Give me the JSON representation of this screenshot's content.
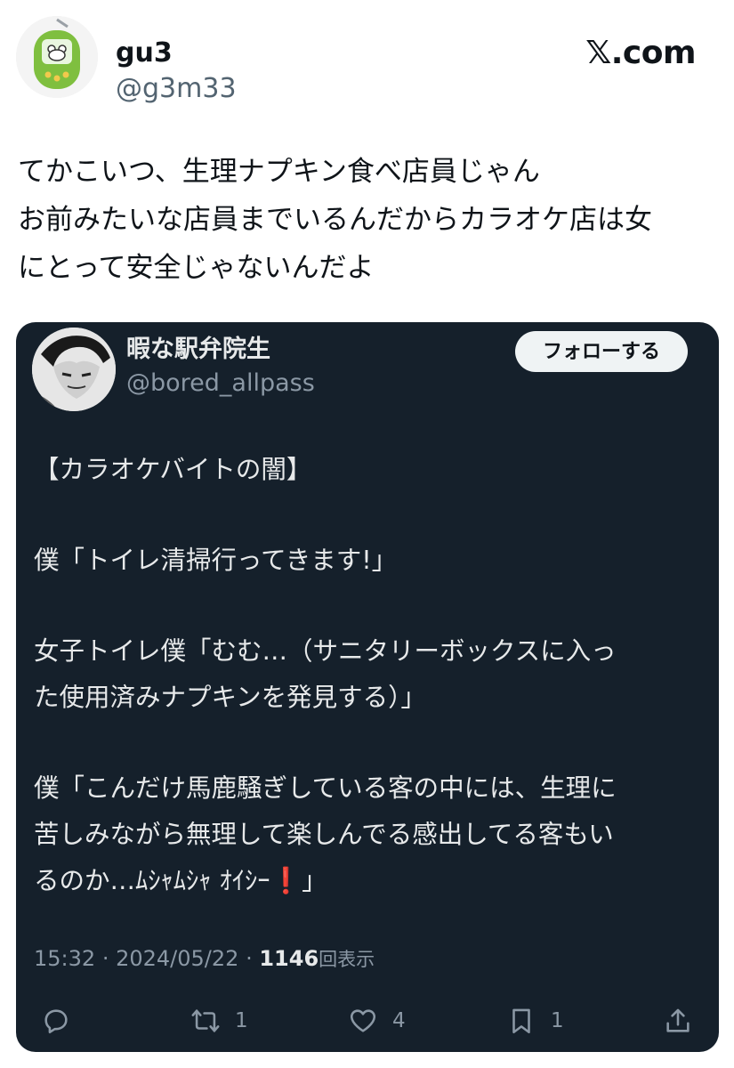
{
  "outer": {
    "name": "gu3",
    "handle": "@g3m33",
    "site_logo": "𝕏.com",
    "text_lines": [
      "てかこいつ、生理ナプキン食べ店員じゃん",
      "お前みたいな店員までいるんだからカラオケ店は女",
      "にとって安全じゃないんだよ"
    ]
  },
  "quoted": {
    "name": "暇な駅弁院生",
    "handle": "@bored_allpass",
    "follow_label": "フォローする",
    "lines": {
      "l1": "【カラオケバイトの闇】",
      "l2": "僕「トイレ清掃行ってきます!」",
      "l3": "女子トイレ僕「むむ…（サニタリーボックスに入っ",
      "l4": "た使用済みナプキンを発見する）」",
      "l5": "僕「こんだけ馬鹿騒ぎしている客の中には、生理に",
      "l6": "苦しみながら無理して楽しんでる感出してる客もい",
      "l7_start": "るのか…ﾑｼｬﾑｼｬ ｵｲｼｰ",
      "l7_excl": "❗",
      "l7_end": "」"
    },
    "meta": {
      "time": "15:32",
      "sep1": "·",
      "date": "2024/05/22",
      "sep2": "·",
      "views": "1146",
      "views_label": "回表示"
    },
    "actions": {
      "reply_icon": "reply-icon",
      "retweet_count": "1",
      "like_count": "4",
      "bookmark_count": "1",
      "share_icon": "share-icon"
    }
  },
  "colors": {
    "card_bg": "#15202b",
    "card_text": "#e7e9ea",
    "muted": "#8b98a5",
    "outer_muted": "#536471",
    "exclamation": "#e0245e"
  }
}
